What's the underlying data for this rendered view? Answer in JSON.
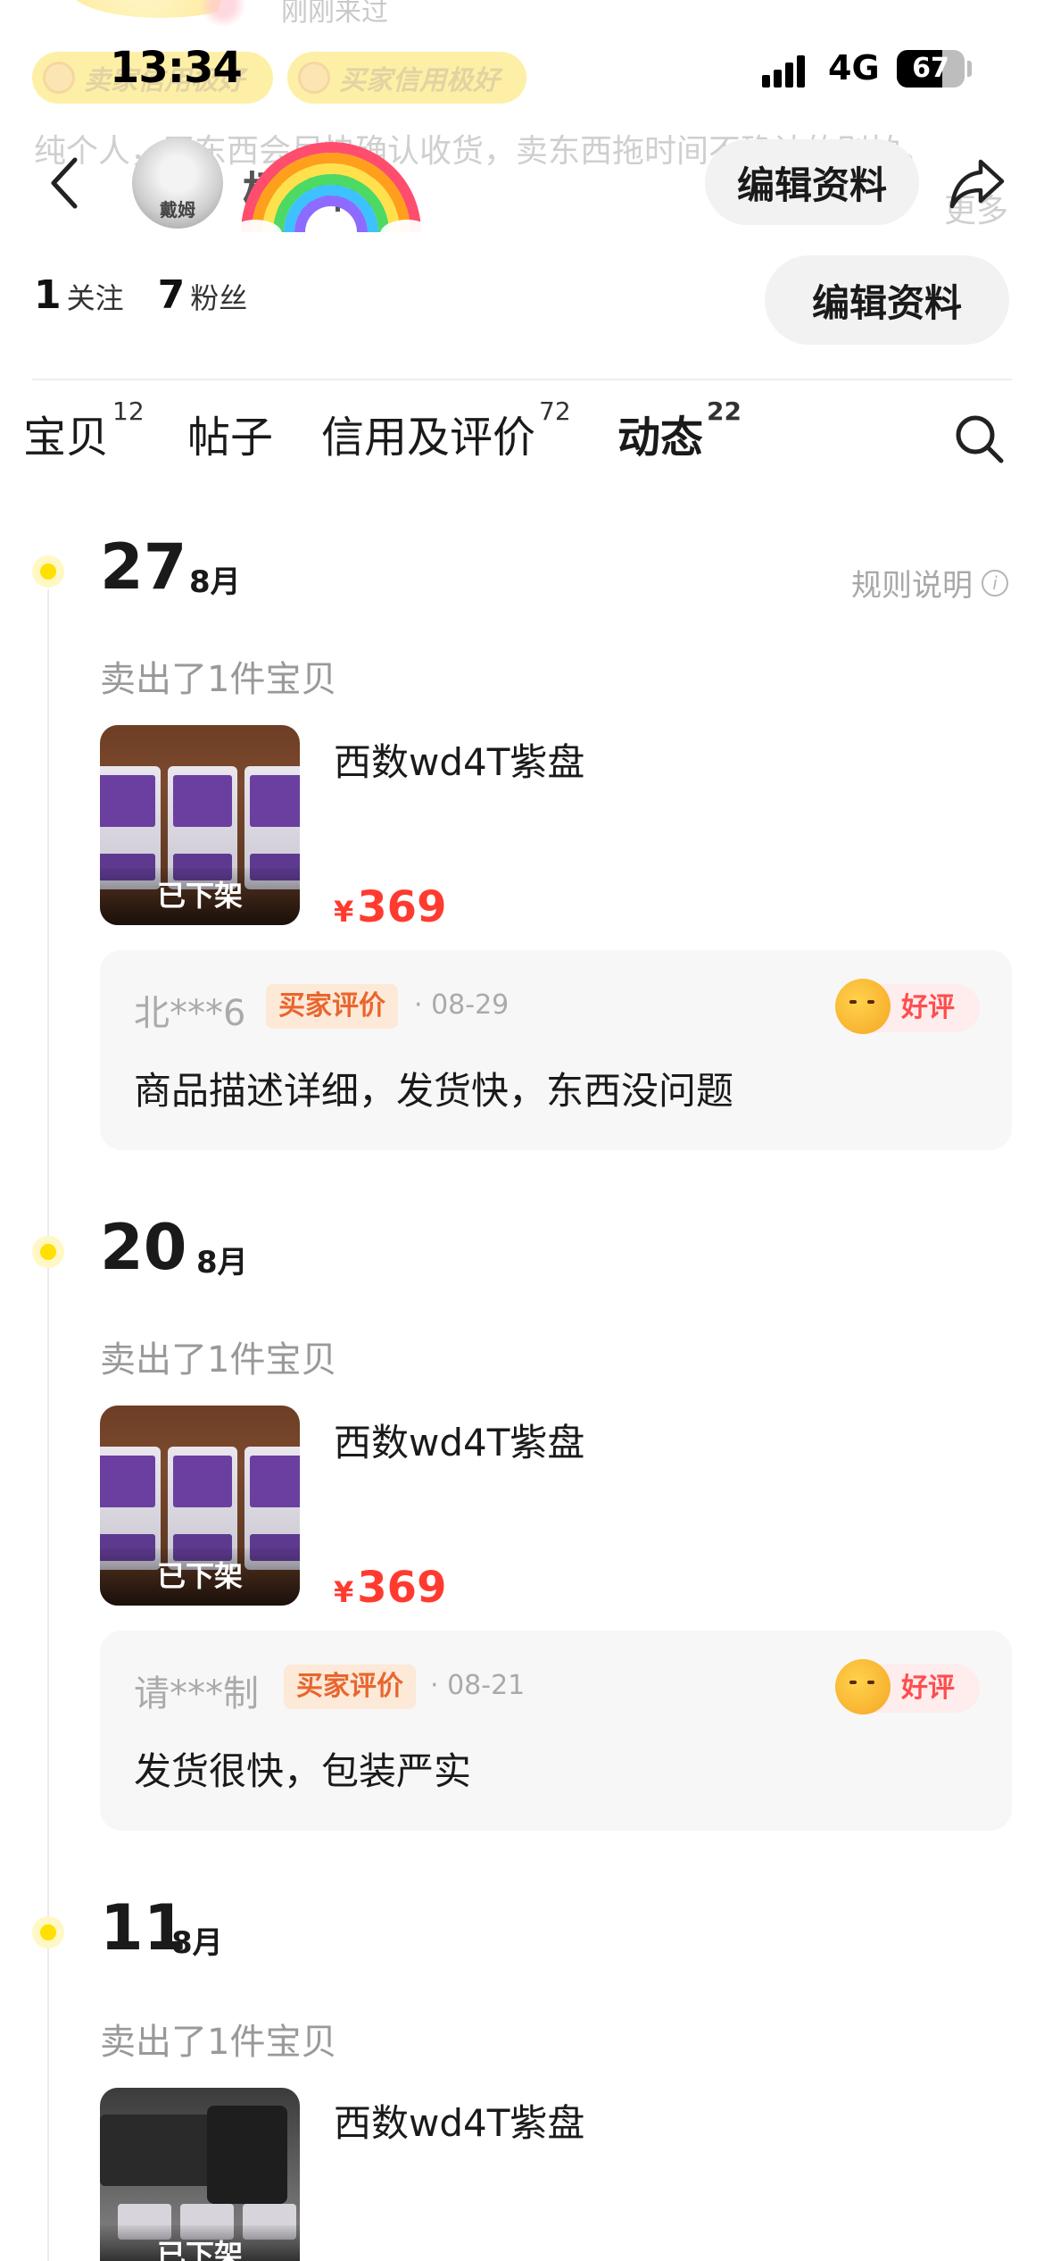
{
  "status": {
    "time": "13:34",
    "network": "4G",
    "battery": "67",
    "battery_level": 0.67
  },
  "profile_bg": {
    "just_came": "刚刚来过",
    "credit_badges": [
      "卖家信用极好",
      "买家信用极好"
    ],
    "bio": "纯个人，买东西会尽快确认收货，卖东西拖时间不确认的别拍。",
    "more": "更多"
  },
  "nav": {
    "avatar_label": "戴姆",
    "name": "杨小雨",
    "edit_label": "编辑资料"
  },
  "stats": {
    "follow_count": "1",
    "follow_label": "关注",
    "fans_count": "7",
    "fans_label": "粉丝",
    "edit_label": "编辑资料"
  },
  "tabs": [
    {
      "label": "宝贝",
      "count": "12"
    },
    {
      "label": "帖子",
      "count": ""
    },
    {
      "label": "信用及评价",
      "count": "72"
    },
    {
      "label": "动态",
      "count": "22"
    }
  ],
  "rules_label": "规则说明",
  "timeline": [
    {
      "day": "27",
      "month": "8月",
      "action": "卖出了1件宝贝",
      "item": {
        "title": "西数wd4T紫盘",
        "currency": "¥",
        "price": "369",
        "status": "已下架"
      },
      "review": {
        "reviewer": "北***6",
        "tag": "买家评价",
        "date": "· 08-29",
        "rating": "好评",
        "text": "商品描述详细，发货快，东西没问题"
      }
    },
    {
      "day": "20",
      "month": "8月",
      "action": "卖出了1件宝贝",
      "item": {
        "title": "西数wd4T紫盘",
        "currency": "¥",
        "price": "369",
        "status": "已下架"
      },
      "review": {
        "reviewer": "请***制",
        "tag": "买家评价",
        "date": "· 08-21",
        "rating": "好评",
        "text": "发货很快，包装严实"
      }
    },
    {
      "day": "11",
      "month": "8月",
      "action": "卖出了1件宝贝",
      "item": {
        "title": "西数wd4T紫盘",
        "currency": "¥",
        "price": "",
        "status": "已下架"
      }
    }
  ],
  "colors": {
    "accent_yellow": "#ffe400",
    "price_red": "#ff3b30",
    "tag_orange": "#e8662e",
    "good_red": "#ff4d4f"
  },
  "icons": [
    "back-arrow-icon",
    "share-icon",
    "search-icon",
    "info-icon",
    "smile-face-icon"
  ]
}
